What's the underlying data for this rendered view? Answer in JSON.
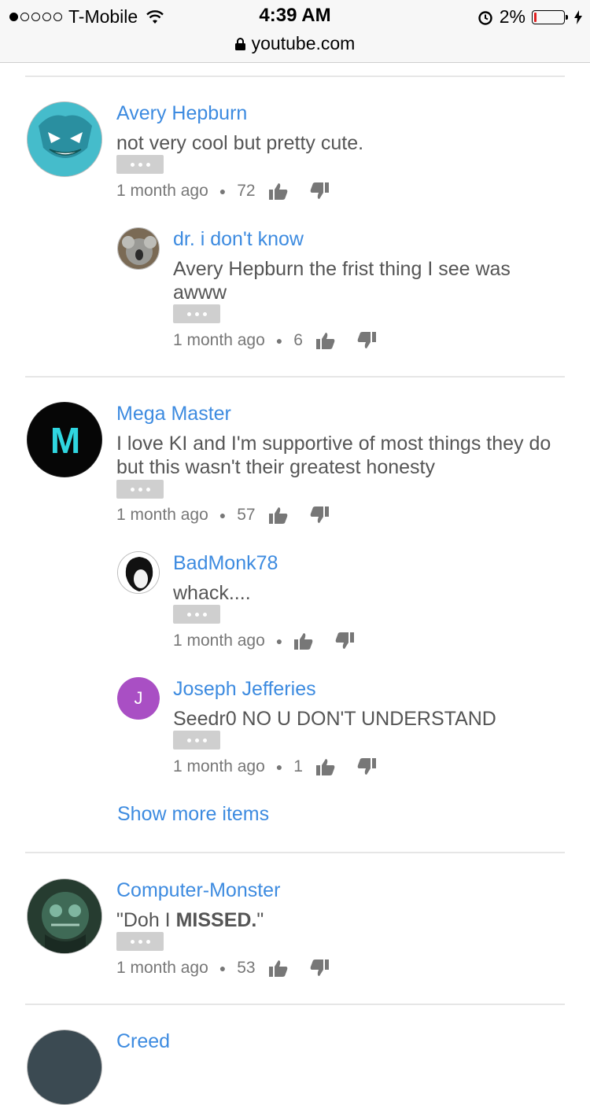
{
  "status_bar": {
    "carrier": "T-Mobile",
    "time": "4:39 AM",
    "battery_percent": "2%",
    "battery_level": 0.02,
    "signal_dots_filled": 1,
    "signal_dots_total": 5
  },
  "url_bar": {
    "domain": "youtube.com"
  },
  "comments": [
    {
      "author": "Avery Hepburn",
      "text": "not very cool but pretty cute.",
      "time": "1 month ago",
      "likes": "72",
      "replies": [
        {
          "author": "dr. i don't know",
          "text": "Avery Hepburn the frist thing I see was awww",
          "time": "1 month ago",
          "likes": "6"
        }
      ]
    },
    {
      "author": "Mega Master",
      "avatar_letter": "M",
      "text": "I love KI and I'm supportive of most things they do but this wasn't their greatest honesty",
      "time": "1 month ago",
      "likes": "57",
      "replies": [
        {
          "author": "BadMonk78",
          "text": "whack....",
          "time": "1 month ago",
          "likes": ""
        },
        {
          "author": "Joseph Jefferies",
          "avatar_letter": "J",
          "text": "Seedr0 NO U DON'T UNDERSTAND",
          "time": "1 month ago",
          "likes": "1"
        }
      ],
      "show_more_label": "Show more items"
    },
    {
      "author": "Computer-Monster",
      "text_prefix": "\"Doh I ",
      "text_bold": "MISSED.",
      "text_suffix": "\"",
      "time": "1 month ago",
      "likes": "53"
    },
    {
      "author": "Creed"
    }
  ],
  "colors": {
    "link_blue": "#3d8be0",
    "text_gray": "#555555",
    "meta_gray": "#777777",
    "joseph_avatar": "#a94fc4"
  },
  "icons": {
    "like": "thumbs-up-icon",
    "dislike": "thumbs-down-icon",
    "more": "ellipsis-icon",
    "lock": "lock-icon",
    "wifi": "wifi-icon",
    "alarm": "alarm-icon",
    "charging": "bolt-icon"
  }
}
